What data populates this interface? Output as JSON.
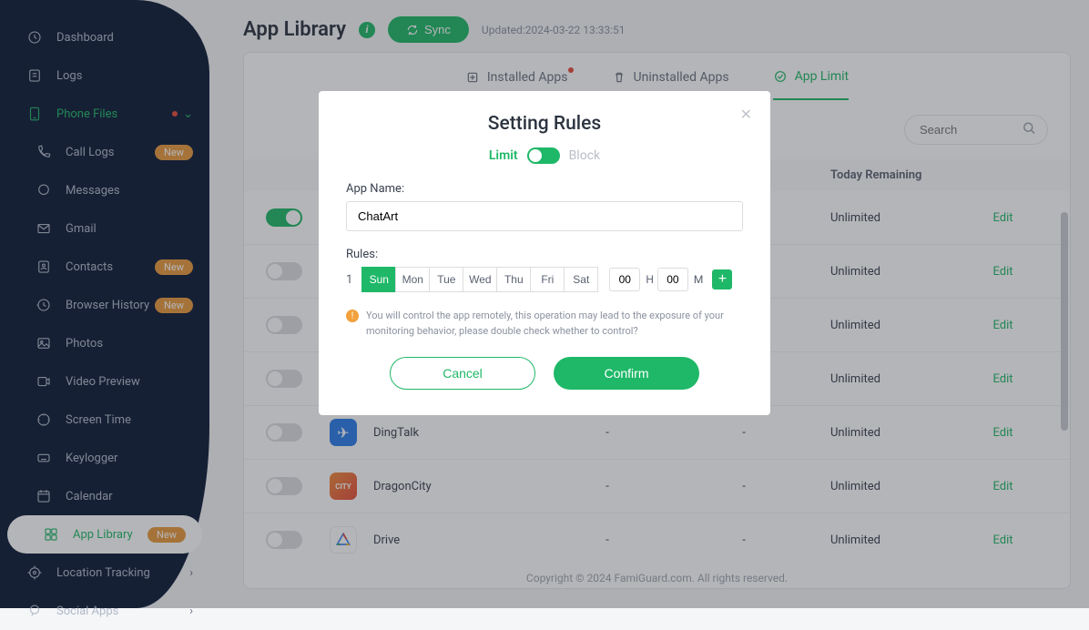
{
  "sidebar": {
    "items": [
      {
        "label": "Dashboard"
      },
      {
        "label": "Logs"
      },
      {
        "label": "Phone Files"
      },
      {
        "label": "Call Logs"
      },
      {
        "label": "Messages"
      },
      {
        "label": "Gmail"
      },
      {
        "label": "Contacts"
      },
      {
        "label": "Browser History"
      },
      {
        "label": "Photos"
      },
      {
        "label": "Video Preview"
      },
      {
        "label": "Screen Time"
      },
      {
        "label": "Keylogger"
      },
      {
        "label": "Calendar"
      },
      {
        "label": "App Library"
      },
      {
        "label": "Location Tracking"
      },
      {
        "label": "Social Apps"
      }
    ],
    "new_badge": "New"
  },
  "page": {
    "title": "App Library",
    "sync": "Sync",
    "updated": "Updated:2024-03-22 13:33:51"
  },
  "tabs": {
    "installed": "Installed Apps",
    "uninstalled": "Uninstalled Apps",
    "limit": "App Limit"
  },
  "search": {
    "placeholder": "Search"
  },
  "table": {
    "headers": {
      "remain": "Today Remaining"
    },
    "rows": [
      {
        "toggle": true,
        "name": "",
        "t1": "",
        "t2": "",
        "remain": "Unlimited",
        "op": "Edit",
        "bg": "#1fb868"
      },
      {
        "toggle": false,
        "name": "",
        "t1": "",
        "t2": "",
        "remain": "Unlimited",
        "op": "Edit",
        "bg": "#3b7ce8"
      },
      {
        "toggle": false,
        "name": "",
        "t1": "",
        "t2": "",
        "remain": "Unlimited",
        "op": "Edit",
        "bg": "#3b7ce8"
      },
      {
        "toggle": false,
        "name": "",
        "t1": "",
        "t2": "",
        "remain": "Unlimited",
        "op": "Edit",
        "bg": "#3b7ce8"
      },
      {
        "toggle": false,
        "name": "DingTalk",
        "t1": "-",
        "t2": "-",
        "remain": "Unlimited",
        "op": "Edit",
        "bg": "#2b7de9"
      },
      {
        "toggle": false,
        "name": "DragonCity",
        "t1": "-",
        "t2": "-",
        "remain": "Unlimited",
        "op": "Edit",
        "bg": "#f08c3a"
      },
      {
        "toggle": false,
        "name": "Drive",
        "t1": "-",
        "t2": "-",
        "remain": "Unlimited",
        "op": "Edit",
        "bg": "#fff"
      }
    ]
  },
  "footer": "Copyright © 2024 FamiGuard.com. All rights reserved.",
  "modal": {
    "title": "Setting Rules",
    "limit": "Limit",
    "block": "Block",
    "app_name_label": "App Name:",
    "app_name_value": "ChatArt",
    "rules_label": "Rules:",
    "rule_num": "1",
    "days": [
      "Sun",
      "Mon",
      "Tue",
      "Wed",
      "Thu",
      "Fri",
      "Sat"
    ],
    "hour": "00",
    "h": "H",
    "min": "00",
    "m": "M",
    "warn": "You will control the app remotely, this operation may lead to the exposure of your monitoring behavior, please double check whether to control?",
    "cancel": "Cancel",
    "confirm": "Confirm"
  }
}
